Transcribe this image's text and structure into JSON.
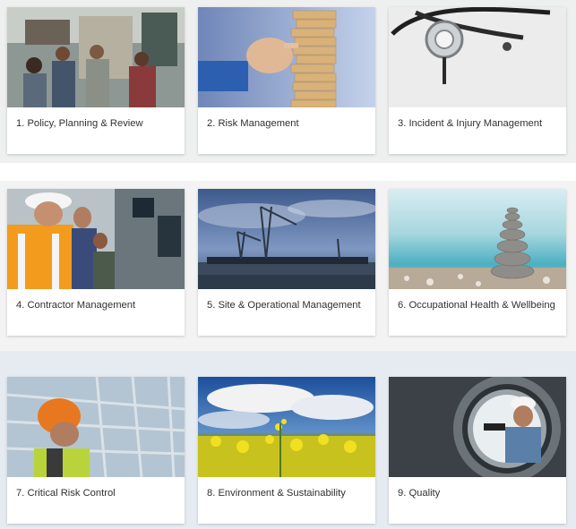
{
  "tiles": [
    {
      "label": "1. Policy, Planning & Review",
      "image": "team-meeting-photo"
    },
    {
      "label": "2. Risk Management",
      "image": "jenga-tower-photo"
    },
    {
      "label": "3. Incident & Injury Management",
      "image": "stethoscope-photo"
    },
    {
      "label": "4. Contractor Management",
      "image": "contractors-control-room-photo"
    },
    {
      "label": "5. Site & Operational Management",
      "image": "port-cranes-photo"
    },
    {
      "label": "6. Occupational Health & Wellbeing",
      "image": "stacked-stones-photo"
    },
    {
      "label": "7. Critical Risk Control",
      "image": "hard-hat-worker-photo"
    },
    {
      "label": "8. Environment & Sustainability",
      "image": "canola-field-photo"
    },
    {
      "label": "9. Quality",
      "image": "pipe-inspection-photo"
    }
  ]
}
